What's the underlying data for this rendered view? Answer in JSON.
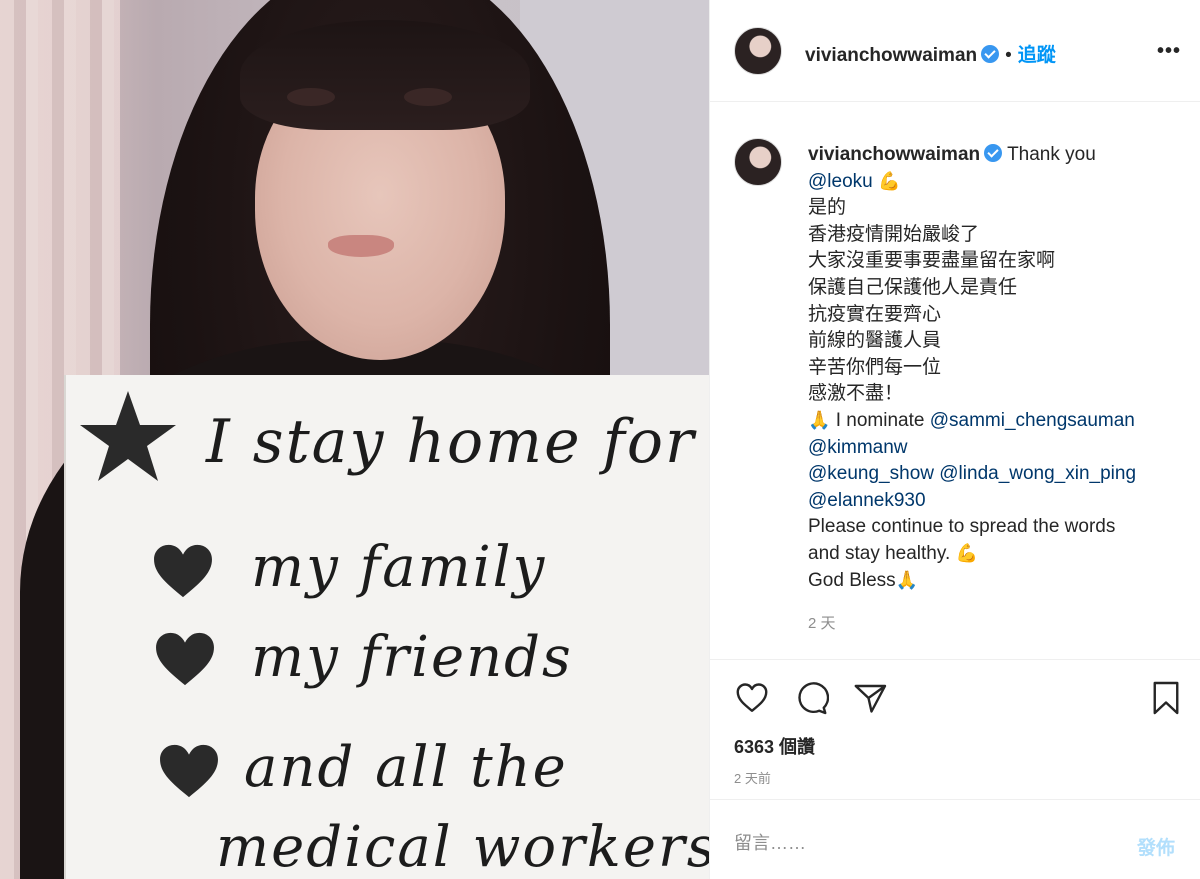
{
  "photo": {
    "sign_lines": [
      "I stay home for",
      "my family",
      "my friends",
      "and all the",
      "medical workers"
    ]
  },
  "header": {
    "username": "vivianchowwaiman",
    "separator": "•",
    "follow_label": "追蹤",
    "more_label": "•••"
  },
  "caption": {
    "username": "vivianchowwaiman",
    "first_text": "Thank you",
    "line_leoku": "@leoku",
    "emoji_flex": "💪",
    "lines_cn": [
      "是的",
      "香港疫情開始嚴峻了",
      "大家沒重要事要盡量留在家啊",
      "保護自己保護他人是責任",
      "抗疫實在要齊心",
      "前線的醫護人員",
      "辛苦你們每一位",
      "感激不盡！"
    ],
    "emoji_pray": "🙏",
    "nominate_text": "I nominate",
    "mentions": [
      "@sammi_chengsauman",
      "@kimmanw",
      "@keung_show",
      "@linda_wong_xin_ping",
      "@elannek930"
    ],
    "continue_text": "Please continue to spread the words",
    "stay_text": "and stay healthy.",
    "bless_text": "God Bless",
    "time": "2 天"
  },
  "actions": {
    "icons": [
      "heart-icon",
      "comment-icon",
      "share-icon",
      "bookmark-icon"
    ],
    "likes": "6363 個讚",
    "time": "2 天前"
  },
  "comment": {
    "placeholder": "留言……",
    "post_label": "發佈"
  },
  "colors": {
    "accent": "#0095f6",
    "mention": "#00376b",
    "muted": "#8e8e8e",
    "post_disabled": "#b2dffc"
  }
}
